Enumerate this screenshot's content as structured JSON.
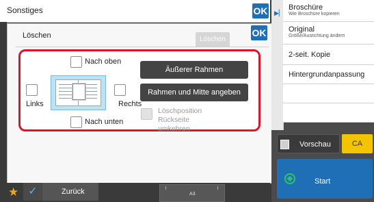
{
  "header": {
    "title": "Sonstiges",
    "ok_label": "OK"
  },
  "panel": {
    "title": "Löschen",
    "top_button_label": "Löschen",
    "ok_label": "OK",
    "checkboxes": {
      "top": "Nach oben",
      "left": "Links",
      "right": "Rechts",
      "bottom": "Nach unten"
    },
    "buttons": {
      "outer_frame": "Äußerer Rahmen",
      "frame_and_center": "Rahmen und Mitte angeben"
    },
    "disabled_option": "Löschposition Rückseite umkehren"
  },
  "bottom_bar": {
    "back_label": "Zurück",
    "paper_size": "A3"
  },
  "right_menu": [
    {
      "title": "Broschüre",
      "subtitle": "Wie Broschüre kopieren"
    },
    {
      "title": "Original",
      "subtitle": "Größe/Ausrichtung ändern"
    },
    {
      "title": "2-seit. Kopie",
      "subtitle": ""
    },
    {
      "title": "Hintergrundanpassung",
      "subtitle": ""
    }
  ],
  "actions": {
    "preview_label": "Vorschau",
    "ca_label": "CA",
    "start_label": "Start"
  },
  "colors": {
    "accent": "#1f6fb6",
    "highlight": "#d8162b",
    "ca": "#f2c500",
    "start_icon": "#2fc46a"
  }
}
